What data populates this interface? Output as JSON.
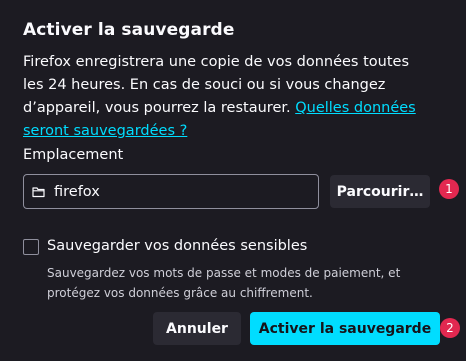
{
  "dialog": {
    "title": "Activer la sauvegarde",
    "description": "Firefox enregistrera une copie de vos données toutes les 24 heures. En cas de souci ou si vous changez d’appareil, vous pourrez la restaurer.",
    "learn_more_link": "Quelles données seront sauvegardées ?"
  },
  "location": {
    "label": "Emplacement",
    "value": "firefox",
    "icon": "folder-icon",
    "browse_button": "Parcourir…"
  },
  "sensitive": {
    "checked": false,
    "label": "Sauvegarder vos données sensibles",
    "help": "Sauvegardez vos mots de passe et modes de paiement, et protégez vos données grâce au chiffrement."
  },
  "actions": {
    "cancel": "Annuler",
    "confirm": "Activer la sauvegarde"
  },
  "markers": [
    "1",
    "2"
  ],
  "colors": {
    "background": "#1c1b22",
    "accent": "#00ddff",
    "marker": "#e22850",
    "secondary_button": "#2b2a33"
  }
}
